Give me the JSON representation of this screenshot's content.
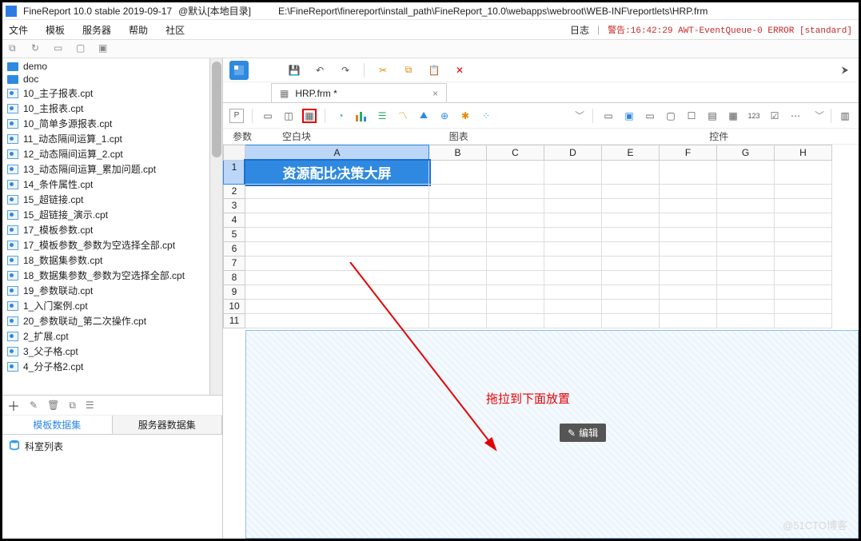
{
  "title": {
    "app": "FineReport 10.0 stable 2019-09-17",
    "context": "@默认[本地目录]",
    "path": "E:\\FineReport\\finereport\\install_path\\FineReport_10.0\\webapps\\webroot\\WEB-INF\\reportlets\\HRP.frm"
  },
  "menu": {
    "file": "文件",
    "template": "模板",
    "server": "服务器",
    "help": "帮助",
    "community": "社区",
    "log": "日志",
    "warn_msg": "警告:16:42:29 AWT-EventQueue-0 ERROR [standard]"
  },
  "tree": {
    "folders": [
      "demo",
      "doc"
    ],
    "files": [
      "10_主子报表.cpt",
      "10_主报表.cpt",
      "10_简单多源报表.cpt",
      "11_动态隔间运算_1.cpt",
      "12_动态隔间运算_2.cpt",
      "13_动态隔间运算_累加问题.cpt",
      "14_条件属性.cpt",
      "15_超链接.cpt",
      "15_超链接_演示.cpt",
      "17_模板参数.cpt",
      "17_模板参数_参数为空选择全部.cpt",
      "18_数据集参数.cpt",
      "18_数据集参数_参数为空选择全部.cpt",
      "19_参数联动.cpt",
      "1_入门案例.cpt",
      "20_参数联动_第二次操作.cpt",
      "2_扩展.cpt",
      "3_父子格.cpt",
      "4_分子格2.cpt"
    ]
  },
  "datasets": {
    "tab_tpl": "模板数据集",
    "tab_srv": "服务器数据集",
    "item1": "科室列表"
  },
  "doc_tab": {
    "name": "HRP.frm *"
  },
  "toolbar_labels": {
    "param": "参数",
    "blank": "空白块",
    "chart": "图表",
    "widget": "控件"
  },
  "sheet": {
    "cols": [
      "A",
      "B",
      "C",
      "D",
      "E",
      "F",
      "G",
      "H"
    ],
    "rows": [
      "1",
      "2",
      "3",
      "4",
      "5",
      "6",
      "7",
      "8",
      "9",
      "10",
      "11"
    ],
    "a1": "资源配比决策大屏"
  },
  "drop": {
    "hint": "拖拉到下面放置",
    "edit": "编辑"
  },
  "watermark": "@51CTO博客"
}
